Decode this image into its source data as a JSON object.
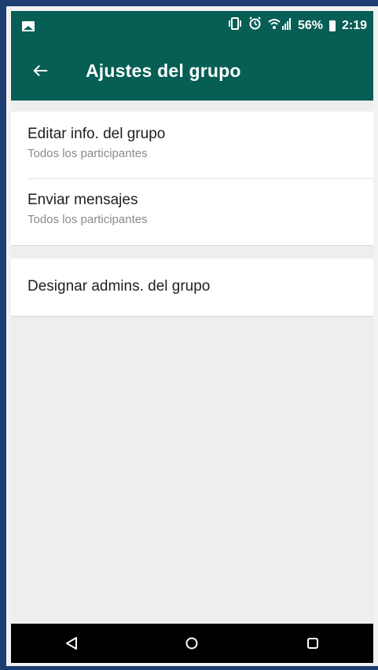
{
  "status_bar": {
    "signal_text": "56%",
    "time": "2:19"
  },
  "toolbar": {
    "title": "Ajustes del grupo"
  },
  "settings": {
    "edit_info": {
      "title": "Editar info. del grupo",
      "subtitle": "Todos los participantes"
    },
    "send_messages": {
      "title": "Enviar mensajes",
      "subtitle": "Todos los participantes"
    },
    "designate_admins": {
      "title": "Designar admins. del grupo"
    }
  },
  "colors": {
    "header": "#075e54",
    "background": "#eeeeee",
    "card": "#ffffff",
    "title_text": "#212121",
    "subtitle_text": "#8a8a8a"
  },
  "icons": {
    "back": "arrow-left-icon",
    "nav_back": "triangle-back-icon",
    "nav_home": "circle-home-icon",
    "nav_recents": "square-recents-icon"
  }
}
